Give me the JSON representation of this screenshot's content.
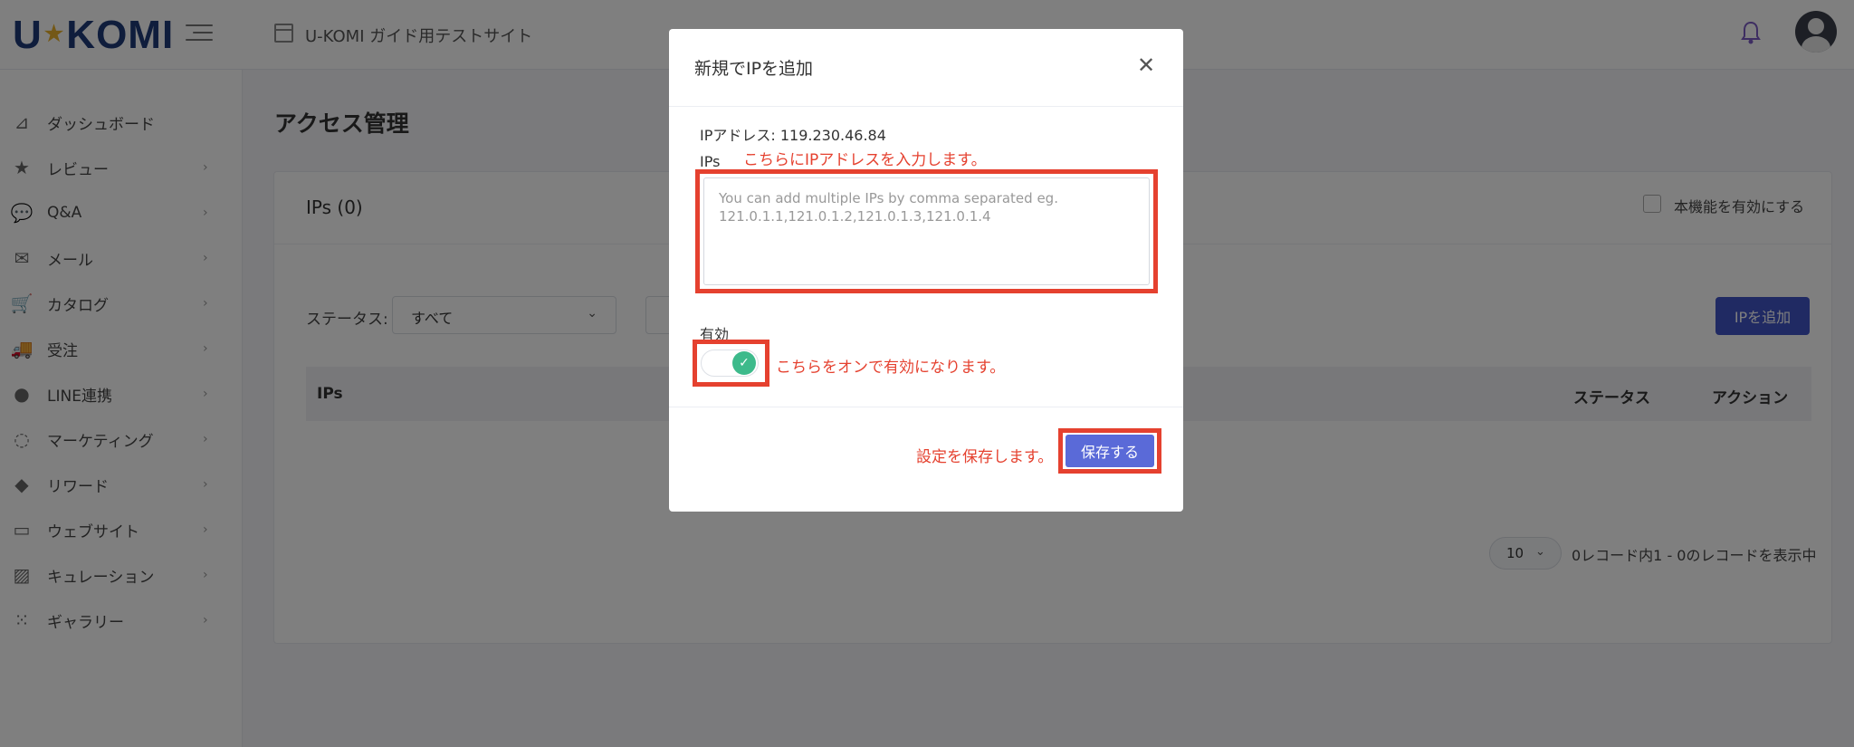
{
  "header": {
    "logo_left": "U",
    "logo_star": "★",
    "logo_right": "KOMI",
    "site_name": "U-KOMI ガイド用テストサイト"
  },
  "sidebar": {
    "items": [
      {
        "label": "ダッシュボード",
        "icon": "dashboard-icon",
        "glyph": "⊿",
        "chevron": ""
      },
      {
        "label": "レビュー",
        "icon": "star-icon",
        "glyph": "★",
        "chevron": "›"
      },
      {
        "label": "Q&A",
        "icon": "chat-icon",
        "glyph": "💬",
        "chevron": "›"
      },
      {
        "label": "メール",
        "icon": "mail-icon",
        "glyph": "✉",
        "chevron": "›"
      },
      {
        "label": "カタログ",
        "icon": "cart-icon",
        "glyph": "🛒",
        "chevron": "›"
      },
      {
        "label": "受注",
        "icon": "truck-icon",
        "glyph": "🚚",
        "chevron": "›"
      },
      {
        "label": "LINE連携",
        "icon": "line-icon",
        "glyph": "●",
        "chevron": "›"
      },
      {
        "label": "マーケティング",
        "icon": "headset-icon",
        "glyph": "◌",
        "chevron": "›"
      },
      {
        "label": "リワード",
        "icon": "ticket-icon",
        "glyph": "◆",
        "chevron": "›"
      },
      {
        "label": "ウェブサイト",
        "icon": "browser-icon",
        "glyph": "▭",
        "chevron": "›"
      },
      {
        "label": "キュレーション",
        "icon": "image-icon",
        "glyph": "▨",
        "chevron": "›"
      },
      {
        "label": "ギャラリー",
        "icon": "grid-icon",
        "glyph": "⁙",
        "chevron": "›"
      }
    ]
  },
  "main": {
    "page_title": "アクセス管理",
    "card_title": "IPs (0)",
    "enable_label": "本機能を有効にする",
    "status_label": "ステータス:",
    "status_value": "すべて",
    "add_ip_label": "IPを追加",
    "table_headers": {
      "ips": "IPs",
      "status": "ステータス",
      "action": "アクション"
    },
    "page_size": "10",
    "record_info": "0レコード内1 - 0のレコードを表示中"
  },
  "modal": {
    "title": "新規でIPを追加",
    "close_glyph": "✕",
    "ip_address": "IPアドレス: 119.230.46.84",
    "ips_label": "IPs",
    "ips_placeholder": "You can add multiple IPs by comma separated eg. 121.0.1.1,121.0.1.2,121.0.1.3,121.0.1.4",
    "enabled_label": "有効",
    "toggle_on": true,
    "save_label": "保存する"
  },
  "annotations": {
    "ips_hint": "こちらにIPアドレスを入力します。",
    "toggle_hint": "こちらをオンで有効になります。",
    "save_hint": "設定を保存します。",
    "color": "#e5412f"
  },
  "colors": {
    "primary": "#4154c7",
    "save_button": "#5a6ad8",
    "toggle_on": "#3dba8b",
    "logo": "#1e3a78"
  }
}
